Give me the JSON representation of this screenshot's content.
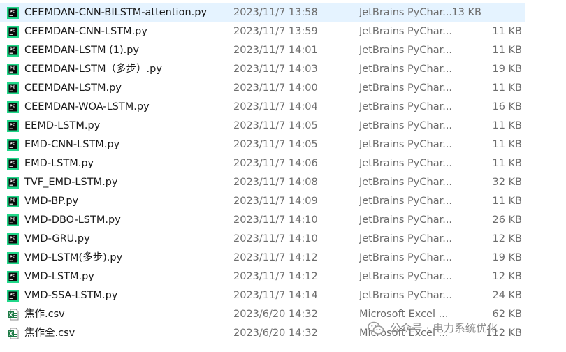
{
  "files": [
    {
      "name": "CEEMDAN-CNN-BILSTM-attention.py",
      "date": "2023/11/7 13:58",
      "type": "JetBrains PyChar...",
      "size": "13 KB",
      "icon": "pycharm-icon",
      "selected": true
    },
    {
      "name": "CEEMDAN-CNN-LSTM.py",
      "date": "2023/11/7 13:59",
      "type": "JetBrains PyChar...",
      "size": "11 KB",
      "icon": "pycharm-icon"
    },
    {
      "name": "CEEMDAN-LSTM (1).py",
      "date": "2023/11/7 14:01",
      "type": "JetBrains PyChar...",
      "size": "11 KB",
      "icon": "pycharm-icon"
    },
    {
      "name": "CEEMDAN-LSTM（多步）.py",
      "date": "2023/11/7 14:03",
      "type": "JetBrains PyChar...",
      "size": "19 KB",
      "icon": "pycharm-icon"
    },
    {
      "name": "CEEMDAN-LSTM.py",
      "date": "2023/11/7 14:00",
      "type": "JetBrains PyChar...",
      "size": "11 KB",
      "icon": "pycharm-icon"
    },
    {
      "name": "CEEMDAN-WOA-LSTM.py",
      "date": "2023/11/7 14:04",
      "type": "JetBrains PyChar...",
      "size": "16 KB",
      "icon": "pycharm-icon"
    },
    {
      "name": "EEMD-LSTM.py",
      "date": "2023/11/7 14:05",
      "type": "JetBrains PyChar...",
      "size": "11 KB",
      "icon": "pycharm-icon"
    },
    {
      "name": "EMD-CNN-LSTM.py",
      "date": "2023/11/7 14:05",
      "type": "JetBrains PyChar...",
      "size": "11 KB",
      "icon": "pycharm-icon"
    },
    {
      "name": "EMD-LSTM.py",
      "date": "2023/11/7 14:06",
      "type": "JetBrains PyChar...",
      "size": "11 KB",
      "icon": "pycharm-icon"
    },
    {
      "name": "TVF_EMD-LSTM.py",
      "date": "2023/11/7 14:08",
      "type": "JetBrains PyChar...",
      "size": "32 KB",
      "icon": "pycharm-icon"
    },
    {
      "name": "VMD-BP.py",
      "date": "2023/11/7 14:09",
      "type": "JetBrains PyChar...",
      "size": "11 KB",
      "icon": "pycharm-icon"
    },
    {
      "name": "VMD-DBO-LSTM.py",
      "date": "2023/11/7 14:10",
      "type": "JetBrains PyChar...",
      "size": "26 KB",
      "icon": "pycharm-icon"
    },
    {
      "name": "VMD-GRU.py",
      "date": "2023/11/7 14:10",
      "type": "JetBrains PyChar...",
      "size": "12 KB",
      "icon": "pycharm-icon"
    },
    {
      "name": "VMD-LSTM(多步).py",
      "date": "2023/11/7 14:12",
      "type": "JetBrains PyChar...",
      "size": "19 KB",
      "icon": "pycharm-icon"
    },
    {
      "name": "VMD-LSTM.py",
      "date": "2023/11/7 14:12",
      "type": "JetBrains PyChar...",
      "size": "12 KB",
      "icon": "pycharm-icon"
    },
    {
      "name": "VMD-SSA-LSTM.py",
      "date": "2023/11/7 14:14",
      "type": "JetBrains PyChar...",
      "size": "24 KB",
      "icon": "pycharm-icon"
    },
    {
      "name": "焦作.csv",
      "date": "2023/6/20 14:32",
      "type": "Microsoft Excel ...",
      "size": "62 KB",
      "icon": "excel-csv-icon"
    },
    {
      "name": "焦作全.csv",
      "date": "2023/6/20 14:32",
      "type": "Microsoft Excel ...",
      "size": "112 KB",
      "icon": "excel-csv-icon"
    }
  ],
  "watermark": {
    "text": "公众号 · 电力系统优化",
    "icon": "wechat-icon"
  },
  "colors": {
    "selection": "#e5f3ff",
    "pycharm_bg": "#0a0a0a",
    "pycharm_green": "#21d789",
    "excel_green": "#1d7a45"
  }
}
